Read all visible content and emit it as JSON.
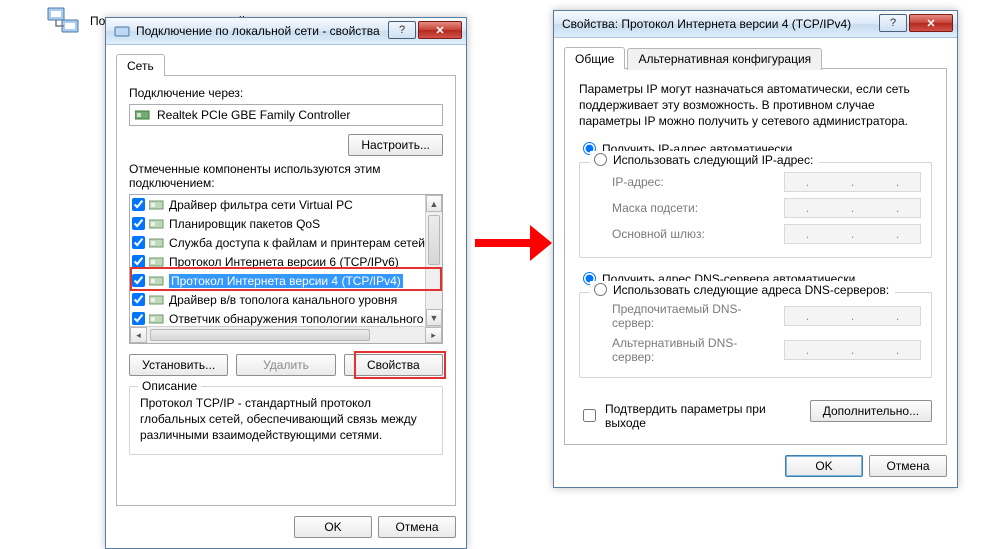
{
  "bg": {
    "lan_label": "Подключение по локальной сети"
  },
  "left": {
    "title": "Подключение по локальной сети - свойства",
    "tab_network": "Сеть",
    "connect_using_label": "Подключение через:",
    "adapter": "Realtek PCIe GBE Family Controller",
    "configure_btn": "Настроить...",
    "components_label": "Отмеченные компоненты используются этим подключением:",
    "components": [
      "Драйвер фильтра сети Virtual PC",
      "Планировщик пакетов QoS",
      "Служба доступа к файлам и принтерам сетей Micro",
      "Протокол Интернета версии 6 (TCP/IPv6)",
      "Протокол Интернета версии 4 (TCP/IPv4)",
      "Драйвер в/в тополога канального уровня",
      "Ответчик обнаружения топологии канального уров"
    ],
    "install_btn": "Установить...",
    "uninstall_btn": "Удалить",
    "properties_btn": "Свойства",
    "description_label": "Описание",
    "description_text": "Протокол TCP/IP - стандартный протокол глобальных сетей, обеспечивающий связь между различными взаимодействующими сетями.",
    "ok": "OK",
    "cancel": "Отмена"
  },
  "right": {
    "title": "Свойства: Протокол Интернета версии 4 (TCP/IPv4)",
    "tab_general": "Общие",
    "tab_alt": "Альтернативная конфигурация",
    "intro": "Параметры IP могут назначаться автоматически, если сеть поддерживает эту возможность. В противном случае параметры IP можно получить у сетевого администратора.",
    "ip_auto": "Получить IP-адрес автоматически",
    "ip_manual": "Использовать следующий IP-адрес:",
    "ip_addr_label": "IP-адрес:",
    "mask_label": "Маска подсети:",
    "gateway_label": "Основной шлюз:",
    "dns_auto": "Получить адрес DNS-сервера автоматически",
    "dns_manual": "Использовать следующие адреса DNS-серверов:",
    "dns_pref_label": "Предпочитаемый DNS-сервер:",
    "dns_alt_label": "Альтернативный DNS-сервер:",
    "validate_chk": "Подтвердить параметры при выходе",
    "advanced_btn": "Дополнительно...",
    "ok": "OK",
    "cancel": "Отмена"
  }
}
